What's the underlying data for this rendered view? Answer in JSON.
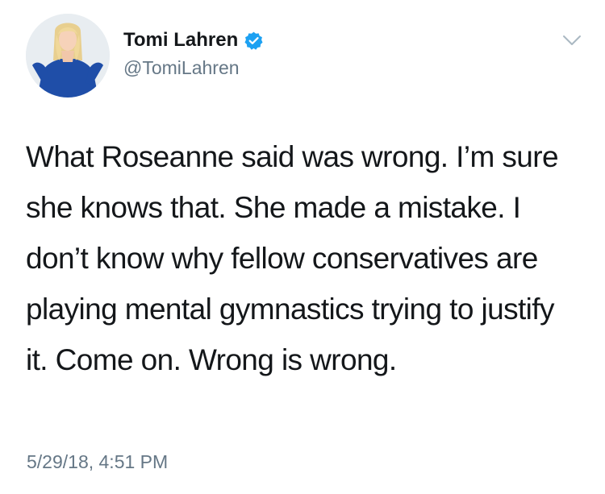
{
  "author": {
    "display_name": "Tomi Lahren",
    "handle": "@TomiLahren",
    "verified": true,
    "avatar_icon": "profile-photo"
  },
  "tweet": {
    "text": "What Roseanne said was wrong. I’m sure she knows that. She made a mistake. I don’t know why fellow conservatives are playing mental gymnastics trying to justify it. Come on. Wrong is wrong.",
    "timestamp": "5/29/18, 4:51 PM"
  },
  "icons": {
    "verified": "verified-badge-icon",
    "menu": "chevron-down-icon"
  },
  "colors": {
    "text": "#14171a",
    "secondary": "#657786",
    "verified": "#1da1f2",
    "background": "#ffffff"
  }
}
